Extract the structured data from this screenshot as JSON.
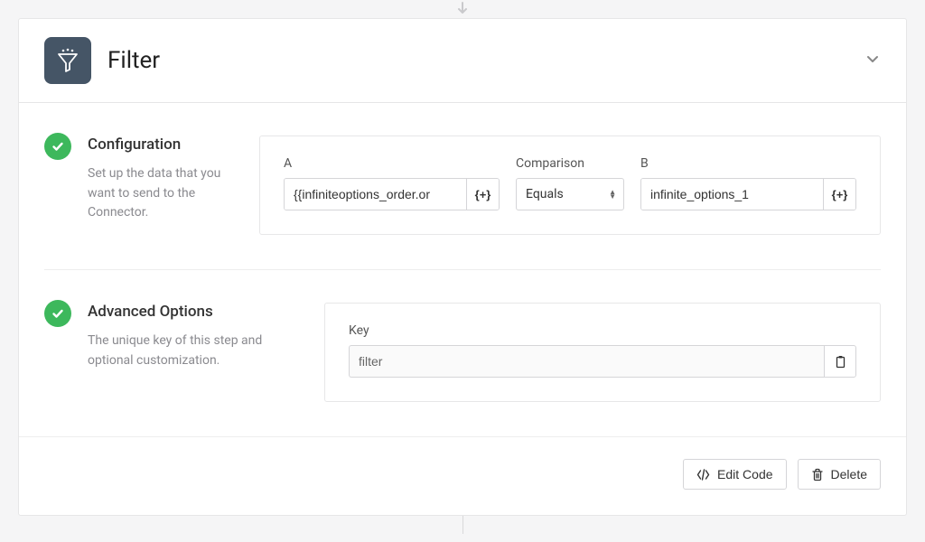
{
  "header": {
    "title": "Filter"
  },
  "configuration": {
    "heading": "Configuration",
    "description": "Set up the data that you want to send to the Connector.",
    "fields": {
      "a_label": "A",
      "a_value": "{{infiniteoptions_order.or",
      "a_token_btn": "{+}",
      "comparison_label": "Comparison",
      "comparison_value": "Equals",
      "b_label": "B",
      "b_value": "infinite_options_1",
      "b_token_btn": "{+}"
    }
  },
  "advanced": {
    "heading": "Advanced Options",
    "description": "The unique key of this step and optional customization.",
    "key_label": "Key",
    "key_value": "filter"
  },
  "footer": {
    "edit_code_label": "Edit Code",
    "delete_label": "Delete"
  }
}
